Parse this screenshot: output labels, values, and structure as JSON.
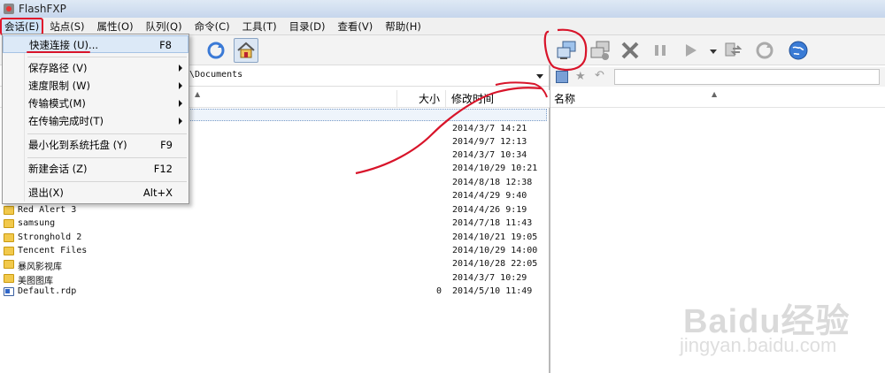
{
  "window": {
    "title": "FlashFXP"
  },
  "menubar": {
    "items": [
      "会话(E)",
      "站点(S)",
      "属性(O)",
      "队列(Q)",
      "命令(C)",
      "工具(T)",
      "目录(D)",
      "查看(V)",
      "帮助(H)"
    ]
  },
  "session_menu": {
    "items": [
      {
        "label": "快速连接 (U)...",
        "shortcut": "F8",
        "submenu": false
      },
      {
        "label": "保存路径 (V)",
        "shortcut": "",
        "submenu": true
      },
      {
        "label": "速度限制 (W)",
        "shortcut": "",
        "submenu": true
      },
      {
        "label": "传输模式(M)",
        "shortcut": "",
        "submenu": true
      },
      {
        "label": "在传输完成时(T)",
        "shortcut": "",
        "submenu": true
      },
      {
        "label": "最小化到系统托盘 (Y)",
        "shortcut": "F9",
        "submenu": false
      },
      {
        "label": "新建会话 (Z)",
        "shortcut": "F12",
        "submenu": false
      },
      {
        "label": "退出(X)",
        "shortcut": "Alt+X",
        "submenu": false
      }
    ]
  },
  "left_pane": {
    "path": "\\Documents",
    "headers": {
      "size": "大小",
      "modified": "修改时间"
    },
    "rows": [
      {
        "name": "",
        "size": "",
        "modified": "2014/3/7 14:21",
        "type": "folder"
      },
      {
        "name": "",
        "size": "",
        "modified": "2014/9/7 12:13",
        "type": "folder"
      },
      {
        "name": "",
        "size": "",
        "modified": "2014/3/7 10:34",
        "type": "folder"
      },
      {
        "name": "",
        "size": "",
        "modified": "2014/10/29 10:21",
        "type": "folder"
      },
      {
        "name": "",
        "size": "",
        "modified": "2014/8/18 12:38",
        "type": "folder"
      },
      {
        "name": "",
        "size": "",
        "modified": "2014/4/29 9:40",
        "type": "folder"
      },
      {
        "name": "Red Alert 3",
        "size": "",
        "modified": "2014/4/26 9:19",
        "type": "folder"
      },
      {
        "name": "samsung",
        "size": "",
        "modified": "2014/7/18 11:43",
        "type": "folder"
      },
      {
        "name": "Stronghold 2",
        "size": "",
        "modified": "2014/10/21 19:05",
        "type": "folder"
      },
      {
        "name": "Tencent Files",
        "size": "",
        "modified": "2014/10/29 14:00",
        "type": "folder"
      },
      {
        "name": "暴风影视库",
        "size": "",
        "modified": "2014/10/28 22:05",
        "type": "folder"
      },
      {
        "name": "美图图库",
        "size": "",
        "modified": "2014/3/7 10:29",
        "type": "folder"
      },
      {
        "name": "Default.rdp",
        "size": "0",
        "modified": "2014/5/10 11:49",
        "type": "file"
      }
    ]
  },
  "right_pane": {
    "headers": {
      "name": "名称"
    }
  },
  "watermark": {
    "text": "Baidu经验",
    "url": "jingyan.baidu.com"
  },
  "colors": {
    "annotation_red": "#d8142a",
    "menu_highlight": "#dce9f7"
  }
}
